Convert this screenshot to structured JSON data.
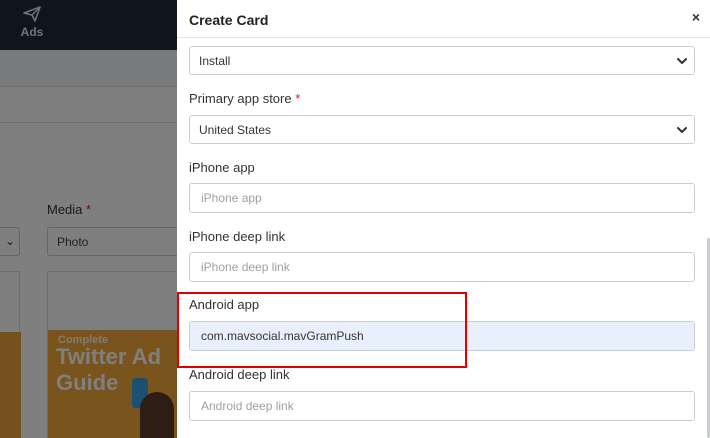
{
  "background": {
    "nav": {
      "ads_label": "Ads"
    },
    "media_label": "Media",
    "media_required": "*",
    "media_value": "Photo",
    "card_art": {
      "line1": "Complete",
      "line2": "Twitter Ad",
      "line3": "Guide"
    }
  },
  "modal": {
    "title": "Create Card",
    "close_icon": "×",
    "call_to_action": {
      "value": "Install"
    },
    "primary_app_store": {
      "label": "Primary app store",
      "required": "*",
      "value": "United States"
    },
    "iphone_app": {
      "label": "iPhone app",
      "placeholder": "iPhone app",
      "value": ""
    },
    "iphone_deep_link": {
      "label": "iPhone deep link",
      "placeholder": "iPhone deep link",
      "value": ""
    },
    "android_app": {
      "label": "Android app",
      "placeholder": "Android app",
      "value": "com.mavsocial.mavGramPush"
    },
    "android_deep_link": {
      "label": "Android deep link",
      "placeholder": "Android deep link",
      "value": ""
    }
  },
  "colors": {
    "highlight": "#e00000",
    "required": "#e02020",
    "autofill_bg": "#e8f0fe",
    "nav_bg": "#1f2a3a"
  }
}
